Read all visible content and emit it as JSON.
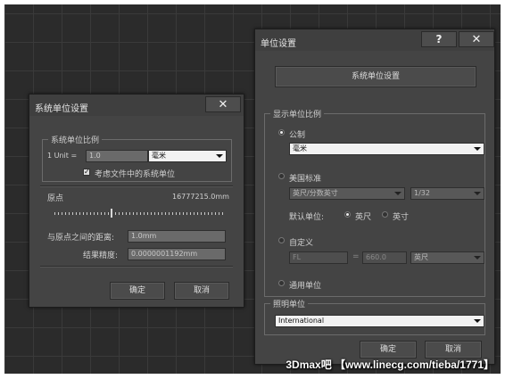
{
  "system_unit_dialog": {
    "title": "系统单位设置",
    "close_glyph": "✕",
    "group_label": "系统单位比例",
    "unit_label": "1 Unit =",
    "unit_value": "1.0",
    "unit_select": "毫米",
    "respect_checkbox_label": "考虑文件中的系统单位",
    "respect_checked": true,
    "origin_label": "原点",
    "origin_value": "16777215.0mm",
    "slider_fraction": 0.33,
    "distance_label": "与原点之间的距离:",
    "distance_value": "1.0mm",
    "precision_label": "结果精度:",
    "precision_value": "0.0000001192mm",
    "ok_label": "确定",
    "cancel_label": "取消"
  },
  "units_setup_dialog": {
    "title": "单位设置",
    "help_glyph": "?",
    "close_glyph": "✕",
    "system_unit_button": "系统单位设置",
    "display_group_label": "显示单位比例",
    "metric_label": "公制",
    "metric_selected": true,
    "metric_select": "毫米",
    "us_label": "美国标准",
    "us_select": "英尺/分数英寸",
    "us_fraction_select": "1/32",
    "default_unit_label": "默认单位:",
    "feet_label": "英尺",
    "inches_label": "英寸",
    "custom_label": "自定义",
    "custom_name": "FL",
    "custom_equals": "=",
    "custom_value": "660.0",
    "custom_unit_select": "英尺",
    "generic_label": "通用单位",
    "lighting_group_label": "照明单位",
    "lighting_select": "International",
    "ok_label": "确定",
    "cancel_label": "取消"
  },
  "watermark": "3Dmax吧 【www.linecg.com/tieba/1771】"
}
